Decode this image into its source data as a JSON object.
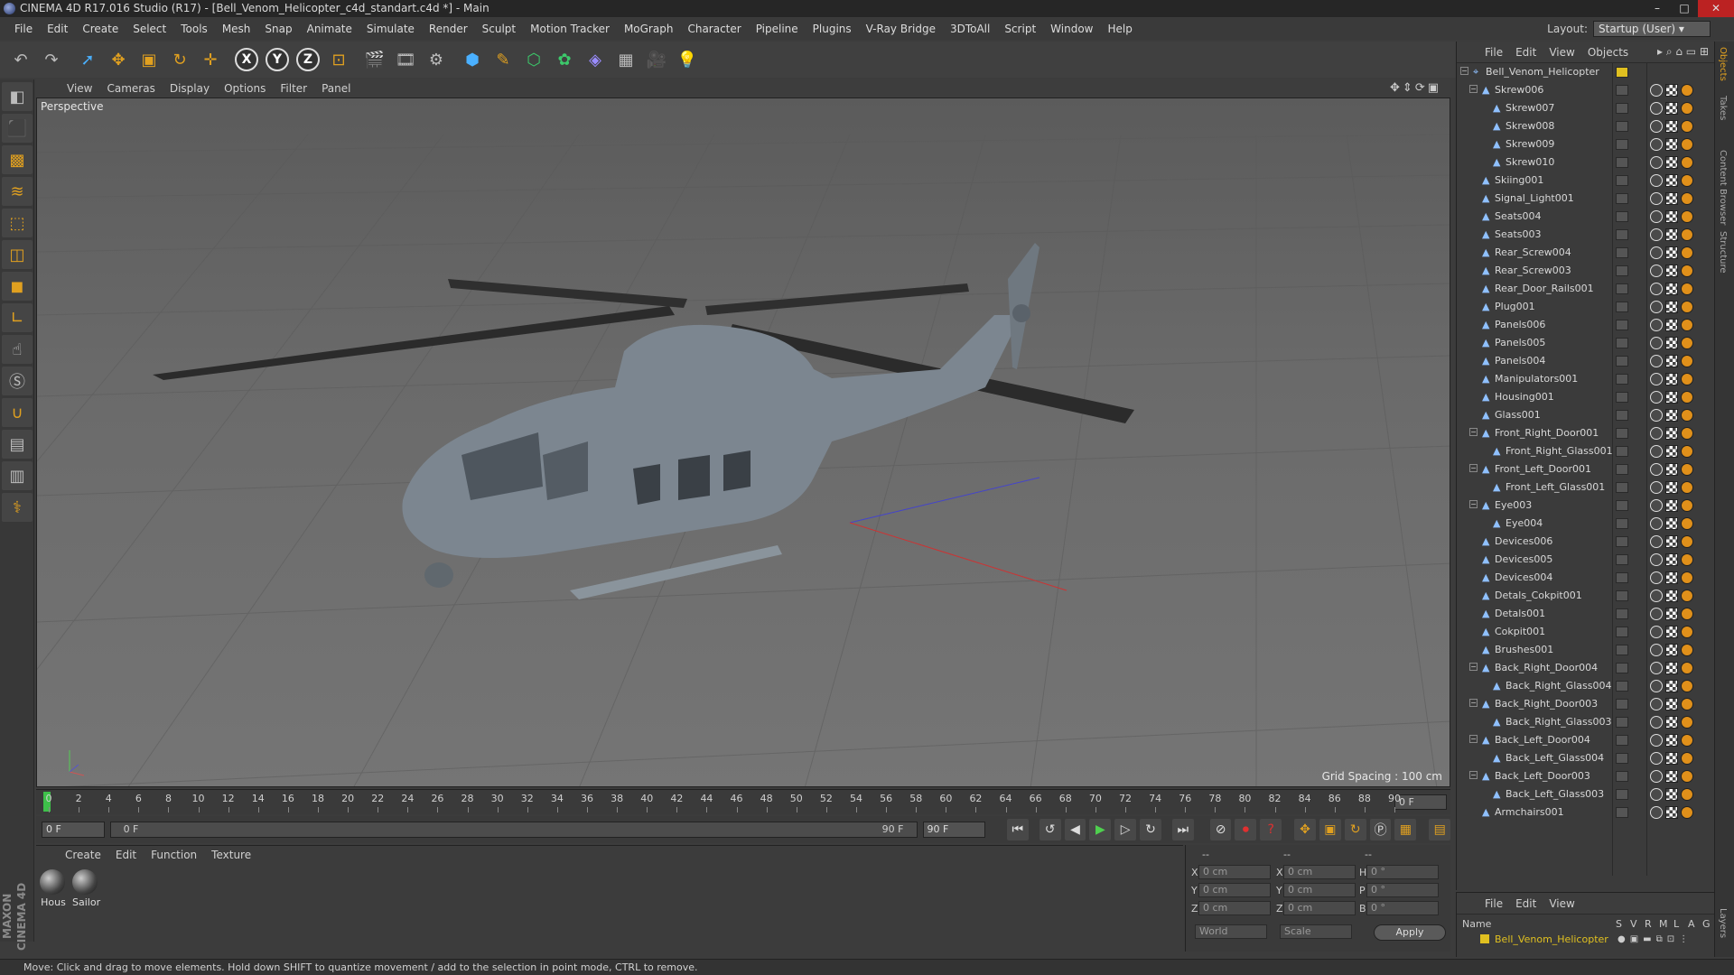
{
  "window": {
    "title": "CINEMA 4D R17.016 Studio (R17) - [Bell_Venom_Helicopter_c4d_standart.c4d *] - Main"
  },
  "menu": [
    "File",
    "Edit",
    "Create",
    "Select",
    "Tools",
    "Mesh",
    "Snap",
    "Animate",
    "Simulate",
    "Render",
    "Sculpt",
    "Motion Tracker",
    "MoGraph",
    "Character",
    "Pipeline",
    "Plugins",
    "V-Ray Bridge",
    "3DToAll",
    "Script",
    "Window",
    "Help"
  ],
  "layout": {
    "label": "Layout:",
    "value": "Startup (User)"
  },
  "viewport": {
    "menu": [
      "View",
      "Cameras",
      "Display",
      "Options",
      "Filter",
      "Panel"
    ],
    "camera_label": "Perspective",
    "grid_spacing": "Grid Spacing : 100 cm"
  },
  "timeline": {
    "ticks": [
      "0",
      "2",
      "4",
      "6",
      "8",
      "10",
      "12",
      "14",
      "16",
      "18",
      "20",
      "22",
      "24",
      "26",
      "28",
      "30",
      "32",
      "34",
      "36",
      "38",
      "40",
      "42",
      "44",
      "46",
      "48",
      "50",
      "52",
      "54",
      "56",
      "58",
      "60",
      "62",
      "64",
      "66",
      "68",
      "70",
      "72",
      "74",
      "76",
      "78",
      "80",
      "82",
      "84",
      "86",
      "88",
      "90"
    ],
    "current_frame": "0 F"
  },
  "transport": {
    "start": "0 F",
    "range_start": "0 F",
    "range_end": "90 F",
    "end": "90 F"
  },
  "material": {
    "menu": [
      "Create",
      "Edit",
      "Function",
      "Texture"
    ],
    "items": [
      {
        "label": "Hous"
      },
      {
        "label": "Sailor"
      }
    ]
  },
  "coords": {
    "header": [
      "--",
      "--",
      "--"
    ],
    "rows": [
      {
        "a": "X",
        "av": "0 cm",
        "b": "X",
        "bv": "0 cm",
        "c": "H",
        "cv": "0 °"
      },
      {
        "a": "Y",
        "av": "0 cm",
        "b": "Y",
        "bv": "0 cm",
        "c": "P",
        "cv": "0 °"
      },
      {
        "a": "Z",
        "av": "0 cm",
        "b": "Z",
        "bv": "0 cm",
        "c": "B",
        "cv": "0 °"
      }
    ],
    "mode1": "World",
    "mode2": "Scale",
    "apply": "Apply"
  },
  "objects": {
    "menu": [
      "File",
      "Edit",
      "View",
      "Objects"
    ],
    "root": "Bell_Venom_Helicopter",
    "items": [
      {
        "name": "Skrew006",
        "level": 1,
        "exp": true
      },
      {
        "name": "Skrew007",
        "level": 2
      },
      {
        "name": "Skrew008",
        "level": 2
      },
      {
        "name": "Skrew009",
        "level": 2
      },
      {
        "name": "Skrew010",
        "level": 2
      },
      {
        "name": "Skiing001",
        "level": 1
      },
      {
        "name": "Signal_Light001",
        "level": 1
      },
      {
        "name": "Seats004",
        "level": 1
      },
      {
        "name": "Seats003",
        "level": 1
      },
      {
        "name": "Rear_Screw004",
        "level": 1
      },
      {
        "name": "Rear_Screw003",
        "level": 1
      },
      {
        "name": "Rear_Door_Rails001",
        "level": 1
      },
      {
        "name": "Plug001",
        "level": 1
      },
      {
        "name": "Panels006",
        "level": 1
      },
      {
        "name": "Panels005",
        "level": 1
      },
      {
        "name": "Panels004",
        "level": 1
      },
      {
        "name": "Manipulators001",
        "level": 1
      },
      {
        "name": "Housing001",
        "level": 1
      },
      {
        "name": "Glass001",
        "level": 1
      },
      {
        "name": "Front_Right_Door001",
        "level": 1,
        "exp": true
      },
      {
        "name": "Front_Right_Glass001",
        "level": 2
      },
      {
        "name": "Front_Left_Door001",
        "level": 1,
        "exp": true
      },
      {
        "name": "Front_Left_Glass001",
        "level": 2
      },
      {
        "name": "Eye003",
        "level": 1,
        "exp": true
      },
      {
        "name": "Eye004",
        "level": 2
      },
      {
        "name": "Devices006",
        "level": 1
      },
      {
        "name": "Devices005",
        "level": 1
      },
      {
        "name": "Devices004",
        "level": 1
      },
      {
        "name": "Detals_Cokpit001",
        "level": 1
      },
      {
        "name": "Detals001",
        "level": 1
      },
      {
        "name": "Cokpit001",
        "level": 1
      },
      {
        "name": "Brushes001",
        "level": 1
      },
      {
        "name": "Back_Right_Door004",
        "level": 1,
        "exp": true
      },
      {
        "name": "Back_Right_Glass004",
        "level": 2
      },
      {
        "name": "Back_Right_Door003",
        "level": 1,
        "exp": true
      },
      {
        "name": "Back_Right_Glass003",
        "level": 2
      },
      {
        "name": "Back_Left_Door004",
        "level": 1,
        "exp": true
      },
      {
        "name": "Back_Left_Glass004",
        "level": 2
      },
      {
        "name": "Back_Left_Door003",
        "level": 1,
        "exp": true
      },
      {
        "name": "Back_Left_Glass003",
        "level": 2
      },
      {
        "name": "Armchairs001",
        "level": 1
      }
    ]
  },
  "layers": {
    "menu": [
      "File",
      "Edit",
      "View"
    ],
    "columns": [
      "Name",
      "S",
      "V",
      "R",
      "M",
      "L",
      "A",
      "G"
    ],
    "row": "Bell_Venom_Helicopter",
    "accent": "#e0c020"
  },
  "right_tabs": [
    "Objects",
    "Takes",
    "Content Browser",
    "Structure",
    "Layers"
  ],
  "status": "Move: Click and drag to move elements. Hold down SHIFT to quantize movement / add to the selection in point mode, CTRL to remove.",
  "brand": "MAXON CINEMA 4D"
}
